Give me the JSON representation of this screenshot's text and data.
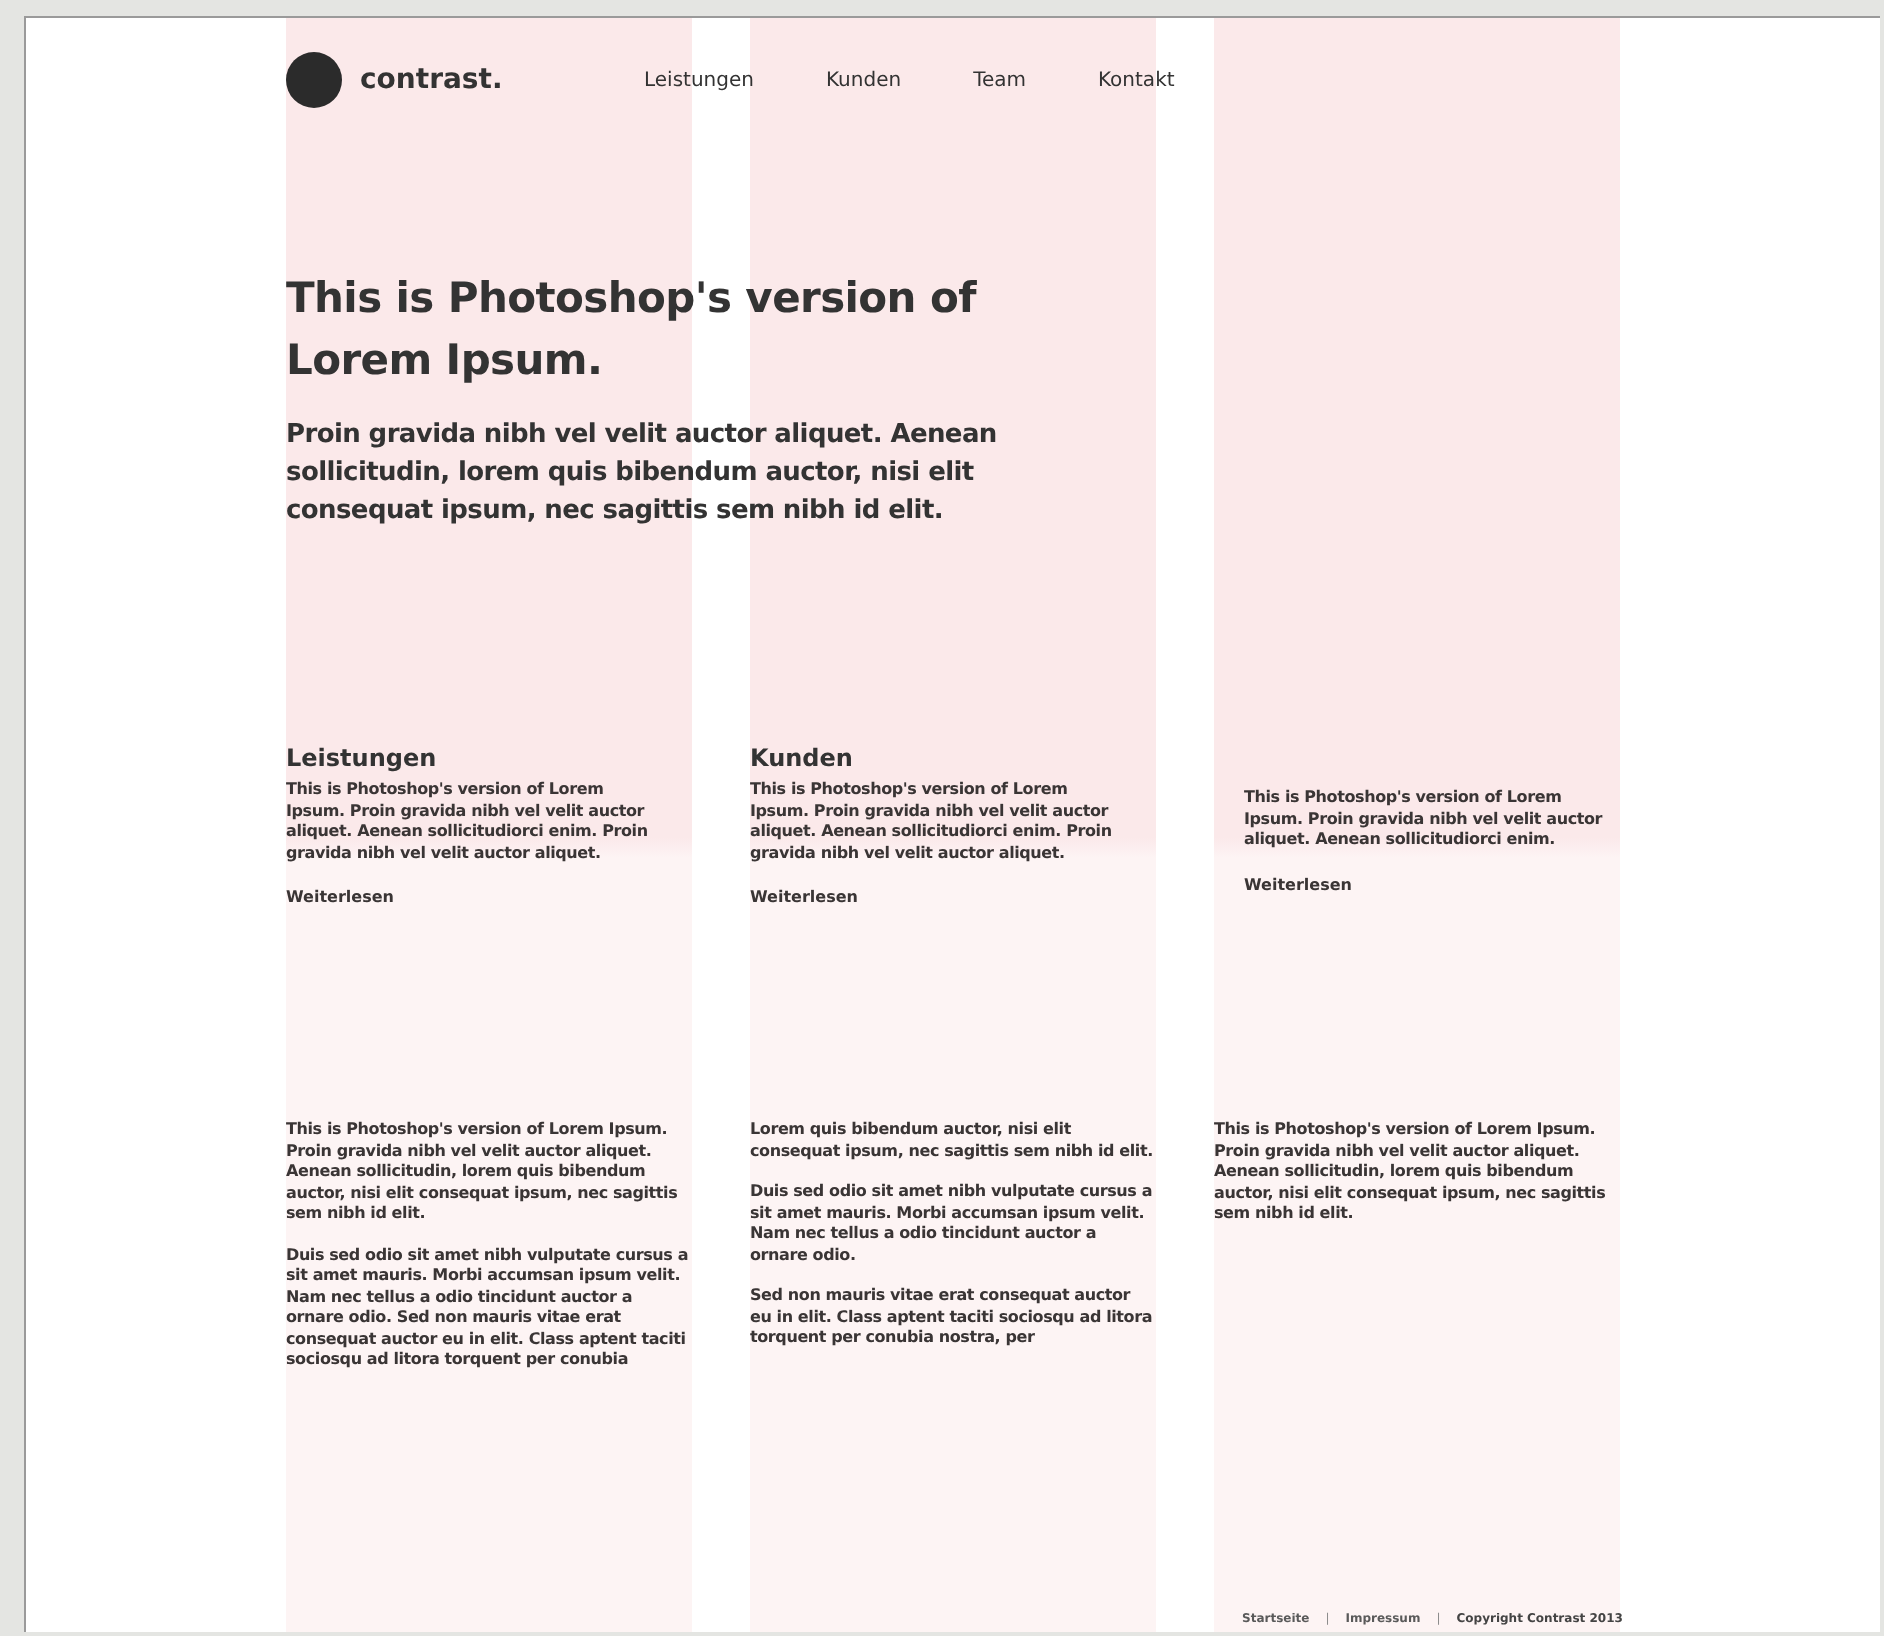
{
  "header": {
    "logo_text": "contrast.",
    "nav": [
      "Leistungen",
      "Kunden",
      "Team",
      "Kontakt"
    ]
  },
  "hero": {
    "title": "This is Photoshop's version of Lorem Ipsum.",
    "lead": "Proin gravida nibh vel velit auctor aliquet. Aenean sollicitudin, lorem quis bibendum auctor, nisi elit consequat ipsum, nec sagittis sem nibh id elit."
  },
  "teasers": [
    {
      "heading": "Leistungen",
      "text": "This is Photoshop's version  of Lorem Ipsum. Proin gravida nibh vel velit auctor aliquet. Aenean sollicitudiorci enim. Proin gravida nibh vel velit auctor aliquet.",
      "link": "Weiterlesen"
    },
    {
      "heading": "Kunden",
      "text": "This is Photoshop's version  of Lorem Ipsum. Proin gravida nibh vel velit auctor aliquet. Aenean sollicitudiorci enim. Proin gravida nibh vel velit auctor aliquet.",
      "link": "Weiterlesen"
    },
    {
      "text": "This is Photoshop's version  of Lorem Ipsum. Proin gravida nibh vel velit auctor aliquet. Aenean sollicitudiorci enim.",
      "link": "Weiterlesen"
    }
  ],
  "columns": [
    [
      "This is Photoshop's version  of Lorem Ipsum. Proin gravida nibh vel velit auctor aliquet. Aenean sollicitudin, lorem quis bibendum auctor, nisi elit consequat ipsum, nec sagittis sem nibh id elit.",
      "Duis sed odio sit amet nibh vulputate cursus a sit amet mauris. Morbi accumsan ipsum velit. Nam nec tellus a odio tincidunt auctor a ornare odio. Sed non  mauris vitae erat consequat auctor eu in elit. Class aptent taciti sociosqu ad litora torquent per conubia"
    ],
    [
      "Lorem quis bibendum auctor, nisi elit consequat ipsum, nec sagittis sem nibh id elit.",
      "Duis sed odio sit amet nibh vulputate cursus a sit amet mauris. Morbi accumsan ipsum velit. Nam nec tellus a odio tincidunt auctor a ornare odio.",
      "Sed non  mauris vitae erat consequat auctor eu in elit. Class aptent taciti sociosqu ad litora torquent per conubia nostra, per"
    ],
    [
      "This is Photoshop's version  of Lorem Ipsum. Proin gravida nibh vel velit auctor aliquet. Aenean sollicitudin, lorem quis bibendum auctor, nisi elit consequat ipsum, nec sagittis sem nibh id elit."
    ]
  ],
  "footer": {
    "items": [
      {
        "kind": "link",
        "text": "Startseite"
      },
      {
        "kind": "separator",
        "text": "|"
      },
      {
        "kind": "link",
        "text": "Impressum"
      },
      {
        "kind": "separator",
        "text": "|"
      },
      {
        "kind": "text",
        "text": "Copyright Contrast 2013"
      }
    ]
  }
}
